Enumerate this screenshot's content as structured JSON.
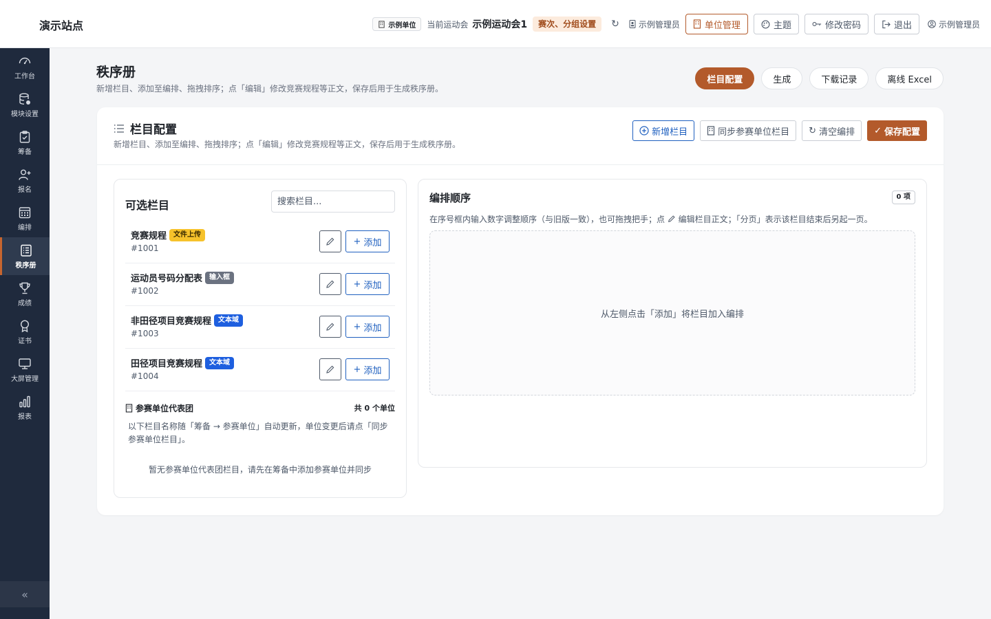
{
  "header": {
    "site_title": "演示站点",
    "unit_tag": "示例单位",
    "current_meet_label": "当前运动会",
    "current_meet": "示例运动会1",
    "round_tag": "赛次、分组设置",
    "admin_label": "示例管理员",
    "buttons": {
      "unit_manage": "单位管理",
      "theme": "主题",
      "change_password": "修改密码",
      "logout": "退出"
    },
    "user_name": "示例管理员",
    "accent_color": "#b35a2b"
  },
  "sidebar": {
    "items": [
      {
        "label": "工作台",
        "icon": "gauge-icon"
      },
      {
        "label": "模块设置",
        "icon": "database-icon"
      },
      {
        "label": "筹备",
        "icon": "clipboard-icon"
      },
      {
        "label": "报名",
        "icon": "user-plus-icon"
      },
      {
        "label": "编排",
        "icon": "calendar-icon"
      },
      {
        "label": "秩序册",
        "icon": "list-doc-icon",
        "active": true
      },
      {
        "label": "成绩",
        "icon": "trophy-icon"
      },
      {
        "label": "证书",
        "icon": "award-icon"
      },
      {
        "label": "大屏管理",
        "icon": "monitor-icon"
      },
      {
        "label": "报表",
        "icon": "bar-chart-icon"
      }
    ],
    "collapse_icon": "double-chevron-left-icon",
    "bg_color": "#1f2a3d"
  },
  "page": {
    "title": "秩序册",
    "description": "新增栏目、添加至编排、拖拽排序；点「编辑」修改竞赛规程等正文，保存后用于生成秩序册。",
    "tabs": [
      "栏目配置",
      "生成",
      "下载记录",
      "离线 Excel"
    ],
    "active_tab": "栏目配置"
  },
  "card": {
    "title": "栏目配置",
    "description": "新增栏目、添加至编排、拖拽排序；点「编辑」修改竞赛规程等正文，保存后用于生成秩序册。",
    "actions": {
      "add_column": "新增栏目",
      "sync_units": "同步参赛单位栏目",
      "clear": "清空编排",
      "save": "保存配置"
    }
  },
  "available": {
    "title": "可选栏目",
    "search_placeholder": "搜索栏目...",
    "items": [
      {
        "name": "竞赛规程",
        "badge": "文件上传",
        "id": "#1001"
      },
      {
        "name": "运动员号码分配表",
        "badge": "输入框",
        "id": "#1002"
      },
      {
        "name": "非田径项目竞赛规程",
        "badge": "文本域",
        "id": "#1003"
      },
      {
        "name": "田径项目竞赛规程",
        "badge": "文本域",
        "id": "#1004"
      }
    ],
    "add_label": "添加",
    "representatives": {
      "title": "参赛单位代表团",
      "count": "共 0 个单位",
      "description": "以下栏目名称随「筹备 → 参赛单位」自动更新，单位变更后请点「同步参赛单位栏目」。",
      "empty": "暂无参赛单位代表团栏目，请先在筹备中添加参赛单位并同步"
    }
  },
  "order": {
    "title": "编排顺序",
    "count": "0 项",
    "description_prefix": "在序号框内输入数字调整顺序（与旧版一致），也可拖拽把手；点",
    "description_suffix": "编辑栏目正文；「分页」表示该栏目结束后另起一页。",
    "empty": "从左侧点击「添加」将栏目加入编排"
  }
}
